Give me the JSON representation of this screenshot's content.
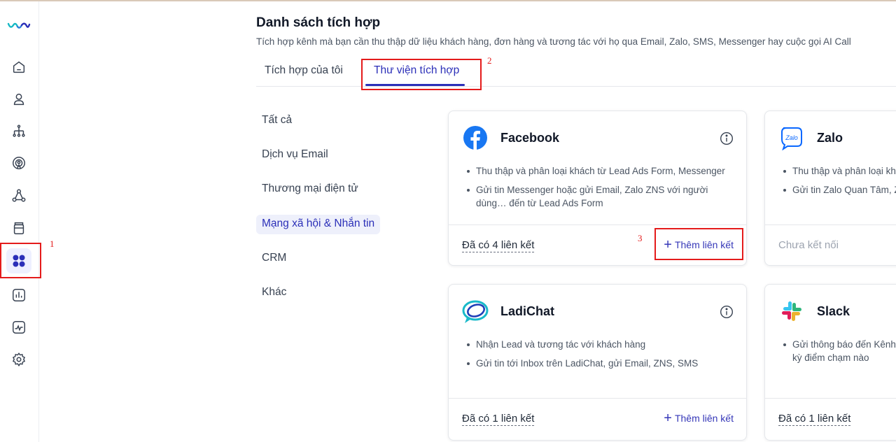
{
  "header": {
    "title": "Danh sách tích hợp",
    "subtitle": "Tích hợp kênh mà bạn cần thu thập dữ liệu khách hàng, đơn hàng và tương tác với họ qua Email, Zalo, SMS, Messenger hay cuộc gọi AI Call"
  },
  "tabs": [
    {
      "label": "Tích hợp của tôi"
    },
    {
      "label": "Thư viện tích hợp"
    }
  ],
  "categories": [
    {
      "label": "Tất cả"
    },
    {
      "label": "Dịch vụ Email"
    },
    {
      "label": "Thương mại điện tử"
    },
    {
      "label": "Mạng xã hội & Nhắn tin"
    },
    {
      "label": "CRM"
    },
    {
      "label": "Khác"
    }
  ],
  "annotations": {
    "n1": "1",
    "n2": "2",
    "n3": "3"
  },
  "cards": [
    {
      "name": "Facebook",
      "icon": "facebook-icon",
      "bullets": [
        "Thu thập và phân loại khách từ Lead Ads Form, Messenger",
        "Gửi tin Messenger hoặc gửi Email, Zalo ZNS với người dùng… đến từ Lead Ads Form"
      ],
      "status": "Đã có 4 liên kết",
      "action": "Thêm liên kết"
    },
    {
      "name": "Zalo",
      "icon": "zalo-icon",
      "bullets": [
        "Thu thập và phân loại kha",
        "Gửi tin Zalo Quan Tâm, Z"
      ],
      "status": "Chưa kết nối",
      "action": ""
    },
    {
      "name": "LadiChat",
      "icon": "ladichat-icon",
      "bullets": [
        "Nhận Lead và tương tác với khách hàng",
        "Gửi tin tới Inbox trên LadiChat, gửi Email, ZNS, SMS"
      ],
      "status": "Đã có 1 liên kết",
      "action": "Thêm liên kết"
    },
    {
      "name": "Slack",
      "icon": "slack-icon",
      "bullets": [
        "Gửi thông báo đến Kênh kỳ điểm chạm nào"
      ],
      "status": "Đã có 1 liên kết",
      "action": ""
    }
  ],
  "colors": {
    "accent": "#2b2fb8",
    "highlight": "#e41b1b",
    "facebook": "#1877f2"
  }
}
